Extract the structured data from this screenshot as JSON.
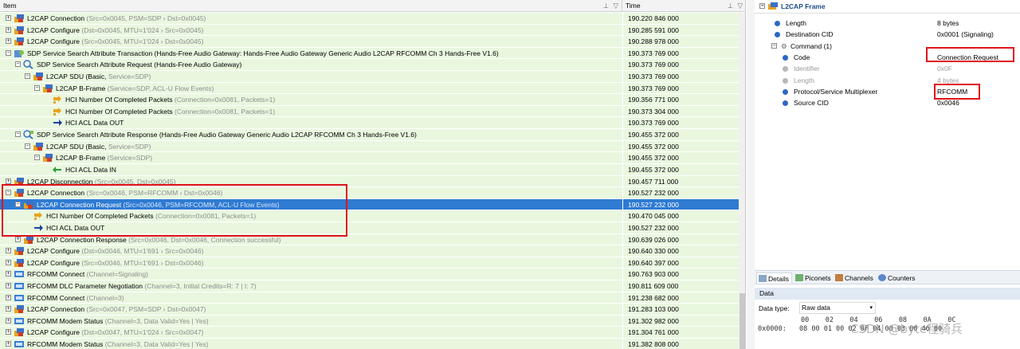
{
  "columns": {
    "item": "Item",
    "time": "Time"
  },
  "rows": [
    {
      "indent": 0,
      "exp": "+",
      "icon": "l2cap",
      "name": "L2CAP Connection",
      "params": "(Src=0x0045, PSM=SDP › Dst=0x0045)",
      "time": "190.220 846 000"
    },
    {
      "indent": 0,
      "exp": "+",
      "icon": "l2cap",
      "name": "L2CAP Configure",
      "params": "(Dst=0x0045, MTU=1'024 › Src=0x0045)",
      "time": "190.285 591 000"
    },
    {
      "indent": 0,
      "exp": "+",
      "icon": "l2cap",
      "name": "L2CAP Configure",
      "params": "(Src=0x0045, MTU=1'024 › Dst=0x0045)",
      "time": "190.288 978 000"
    },
    {
      "indent": 0,
      "exp": "-",
      "icon": "sdp",
      "name": "SDP Service Search Attribute Transaction (Hands-Free Audio Gateway: Hands-Free Audio Gateway Generic Audio L2CAP RFCOMM Ch 3 Hands-Free V1.6)",
      "params": "",
      "time": "190.373 769 000"
    },
    {
      "indent": 1,
      "exp": "-",
      "icon": "sdp-req",
      "name": "SDP Service Search Attribute Request (Hands-Free Audio Gateway)",
      "params": "",
      "time": "190.373 769 000"
    },
    {
      "indent": 2,
      "exp": "-",
      "icon": "l2cap",
      "name": "L2CAP SDU (Basic,",
      "params": "Service=SDP)",
      "time": "190.373 769 000"
    },
    {
      "indent": 3,
      "exp": "-",
      "icon": "l2cap",
      "name": "L2CAP B-Frame",
      "params": "(Service=SDP, ACL-U Flow Events)",
      "time": "190.373 769 000"
    },
    {
      "indent": 4,
      "exp": "",
      "icon": "hci-evt",
      "name": "HCI Number Of Completed Packets",
      "params": "(Connection=0x0081, Packets=1)",
      "time": "190.356 771 000"
    },
    {
      "indent": 4,
      "exp": "",
      "icon": "hci-evt",
      "name": "HCI Number Of Completed Packets",
      "params": "(Connection=0x0081, Packets=1)",
      "time": "190.373 304 000"
    },
    {
      "indent": 4,
      "exp": "",
      "icon": "arrow-out",
      "name": "HCI ACL Data OUT",
      "params": "",
      "time": "190.373 769 000"
    },
    {
      "indent": 1,
      "exp": "-",
      "icon": "sdp-resp",
      "name": "SDP Service Search Attribute Response (Hands-Free Audio Gateway Generic Audio L2CAP RFCOMM Ch 3 Hands-Free V1.6)",
      "params": "",
      "time": "190.455 372 000"
    },
    {
      "indent": 2,
      "exp": "-",
      "icon": "l2cap",
      "name": "L2CAP SDU (Basic,",
      "params": "Service=SDP)",
      "time": "190.455 372 000"
    },
    {
      "indent": 3,
      "exp": "-",
      "icon": "l2cap",
      "name": "L2CAP B-Frame",
      "params": "(Service=SDP)",
      "time": "190.455 372 000"
    },
    {
      "indent": 4,
      "exp": "",
      "icon": "arrow-in",
      "name": "HCI ACL Data IN",
      "params": "",
      "time": "190.455 372 000"
    },
    {
      "indent": 0,
      "exp": "+",
      "icon": "l2cap",
      "name": "L2CAP Disconnection",
      "params": "(Src=0x0045, Dst=0x0045)",
      "time": "190.457 711 000"
    },
    {
      "indent": 0,
      "exp": "-",
      "icon": "l2cap",
      "name": "L2CAP Connection",
      "params": "(Src=0x0046, PSM=RFCOMM › Dst=0x0046)",
      "time": "190.527 232 000"
    },
    {
      "indent": 1,
      "exp": "-",
      "icon": "l2cap",
      "name": "L2CAP Connection Request",
      "params": "(Src=0x0046, PSM=RFCOMM, ACL-U Flow Events)",
      "time": "190.527 232 000",
      "selected": true
    },
    {
      "indent": 2,
      "exp": "",
      "icon": "hci-evt",
      "name": "HCI Number Of Completed Packets",
      "params": "(Connection=0x0081, Packets=1)",
      "time": "190.470 045 000"
    },
    {
      "indent": 2,
      "exp": "",
      "icon": "arrow-out",
      "name": "HCI ACL Data OUT",
      "params": "",
      "time": "190.527 232 000"
    },
    {
      "indent": 1,
      "exp": "+",
      "icon": "l2cap",
      "name": "L2CAP Connection Response",
      "params": "(Src=0x0046, Dst=0x0046, Connection successful)",
      "time": "190.639 026 000"
    },
    {
      "indent": 0,
      "exp": "+",
      "icon": "l2cap",
      "name": "L2CAP Configure",
      "params": "(Dst=0x0046, MTU=1'691 › Src=0x0046)",
      "time": "190.640 330 000"
    },
    {
      "indent": 0,
      "exp": "+",
      "icon": "l2cap",
      "name": "L2CAP Configure",
      "params": "(Src=0x0046, MTU=1'691 › Dst=0x0046)",
      "time": "190.640 397 000"
    },
    {
      "indent": 0,
      "exp": "+",
      "icon": "rfcomm",
      "name": "RFCOMM Connect",
      "params": "(Channel=Signaling)",
      "time": "190.763 903 000"
    },
    {
      "indent": 0,
      "exp": "+",
      "icon": "rfcomm",
      "name": "RFCOMM DLC Parameter Negotiation",
      "params": "(Channel=3, Initial Credits=R: 7 | I: 7)",
      "time": "190.811 609 000"
    },
    {
      "indent": 0,
      "exp": "+",
      "icon": "rfcomm",
      "name": "RFCOMM Connect",
      "params": "(Channel=3)",
      "time": "191.238 682 000"
    },
    {
      "indent": 0,
      "exp": "+",
      "icon": "l2cap",
      "name": "L2CAP Connection",
      "params": "(Src=0x0047, PSM=SDP › Dst=0x0047)",
      "time": "191.283 103 000"
    },
    {
      "indent": 0,
      "exp": "+",
      "icon": "rfcomm",
      "name": "RFCOMM Modem Status",
      "params": "(Channel=3, Data Valid=Yes | Yes)",
      "time": "191.302 982 000"
    },
    {
      "indent": 0,
      "exp": "+",
      "icon": "l2cap",
      "name": "L2CAP Configure",
      "params": "(Dst=0x0047, MTU=1'024 › Src=0x0047)",
      "time": "191.304 761 000"
    },
    {
      "indent": 0,
      "exp": "+",
      "icon": "rfcomm",
      "name": "RFCOMM Modem Status",
      "params": "(Channel=3, Data Valid=Yes | Yes)",
      "time": "191.382 808 000"
    }
  ],
  "details": {
    "title": "L2CAP Frame",
    "props": [
      {
        "label": "Length",
        "value": "8 bytes",
        "level": 1,
        "dim": false,
        "exp": ""
      },
      {
        "label": "Destination CID",
        "value": "0x0001 (Signaling)",
        "level": 1,
        "dim": false,
        "exp": ""
      },
      {
        "label": "Command (1)",
        "value": "",
        "level": 1,
        "dim": false,
        "exp": "-"
      },
      {
        "label": "Code",
        "value": "Connection Request",
        "level": 2,
        "dim": false,
        "exp": ""
      },
      {
        "label": "Identifier",
        "value": "0x0F",
        "level": 2,
        "dim": true,
        "exp": ""
      },
      {
        "label": "Length",
        "value": "4 bytes",
        "level": 2,
        "dim": true,
        "exp": ""
      },
      {
        "label": "Protocol/Service Multiplexer",
        "value": "RFCOMM",
        "level": 2,
        "dim": false,
        "exp": ""
      },
      {
        "label": "Source CID",
        "value": "0x0046",
        "level": 2,
        "dim": false,
        "exp": ""
      }
    ]
  },
  "tabs": [
    {
      "label": "Details",
      "active": true
    },
    {
      "label": "Piconets",
      "active": false
    },
    {
      "label": "Channels",
      "active": false
    },
    {
      "label": "Counters",
      "active": false
    }
  ],
  "data_panel": {
    "title": "Data",
    "type_label": "Data type:",
    "type_value": "Raw data",
    "hex_header": "00    02    04    06    08    0A    0C",
    "hex_offset": "0x0000:",
    "hex_bytes": "08 00 01 00 02 0F 04 00 03 00 46 00"
  },
  "watermark": "CSDN @byte程骑兵"
}
